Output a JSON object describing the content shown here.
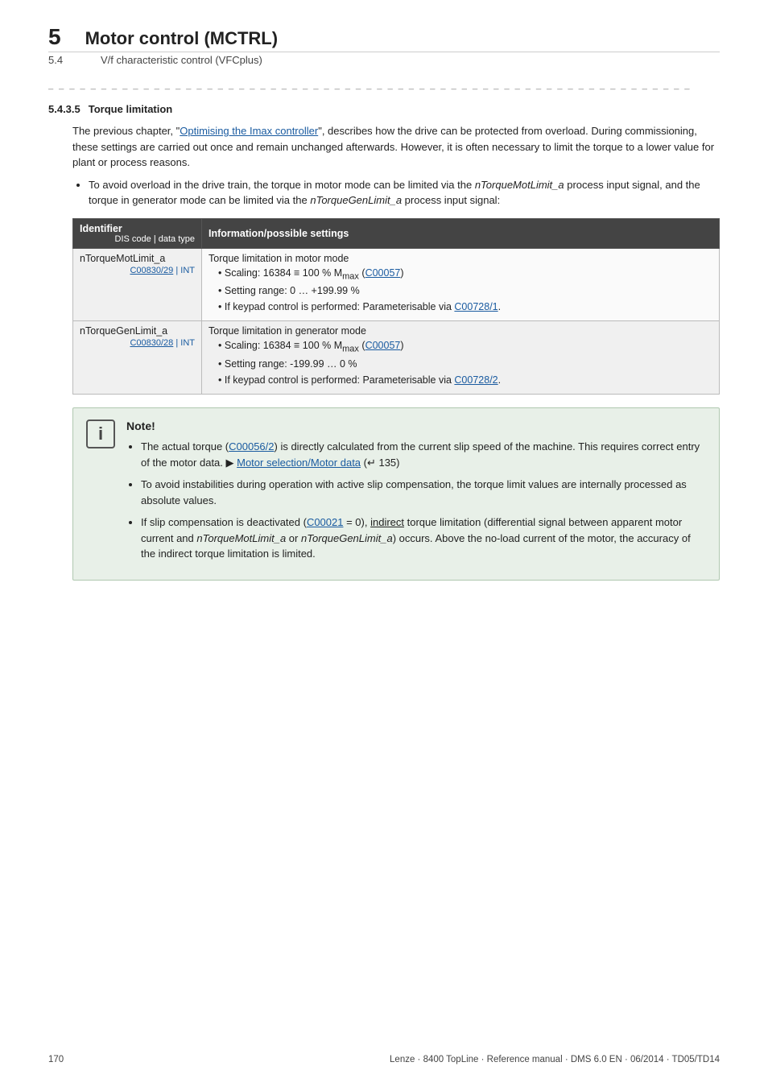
{
  "header": {
    "chapter_number": "5",
    "chapter_title": "Motor control (MCTRL)",
    "sub_number": "5.4",
    "sub_title": "V/f characteristic control (VFCplus)"
  },
  "section": {
    "number": "5.4.3.5",
    "title": "Torque limitation",
    "intro_text": "The previous chapter, \"Optimising the Imax controller\", describes how the drive can be protected from overload. During commissioning, these settings are carried out once and remain unchanged afterwards. However, it is often necessary to limit the torque to a lower value for plant or process reasons.",
    "intro_link_text": "Optimising the Imax controller",
    "bullet_intro": "To avoid overload in the drive train, the torque in motor mode can be limited via the nTorqueMotLimit_a process input signal, and the torque in generator mode can be limited via the nTorqueGenLimit_a process input signal:",
    "table": {
      "col1_header": "Identifier",
      "col1_sub": "DIS code | data type",
      "col2_header": "Information/possible settings",
      "rows": [
        {
          "id_name": "nTorqueMotLimit_a",
          "id_code": "C00830/29 | INT",
          "info_title": "Torque limitation in motor mode",
          "bullets": [
            "Scaling: 16384 ≡ 100 % M<sub>max</sub> (C00057)",
            "Setting range: 0 … +199.99 %",
            "If keypad control is performed: Parameterisable via C00728/1."
          ],
          "links": [
            "C00057",
            "C00728/1"
          ]
        },
        {
          "id_name": "nTorqueGenLimit_a",
          "id_code": "C00830/28 | INT",
          "info_title": "Torque limitation in generator mode",
          "bullets": [
            "Scaling: 16384 ≡ 100 % M<sub>max</sub> (C00057)",
            "Setting range: -199.99 … 0 %",
            "If keypad control is performed: Parameterisable via C00728/2."
          ],
          "links": [
            "C00057",
            "C00728/2"
          ]
        }
      ]
    },
    "note": {
      "title": "Note!",
      "bullets": [
        {
          "text_parts": [
            "The actual torque (",
            "C00056/2",
            ") is directly calculated from the current slip speed of the machine. This requires correct entry of the motor data. ▶ ",
            "Motor selection/Motor data",
            " (↵ 135)"
          ],
          "link1": "C00056/2",
          "link2": "Motor selection/Motor data"
        },
        {
          "text": "To avoid instabilities during operation with active slip compensation, the torque limit values are internally processed as absolute values."
        },
        {
          "text_parts": [
            "If slip compensation is deactivated (",
            "C00021",
            " = 0), indirect torque limitation (differential signal between apparent motor current and ",
            "nTorqueMotLimit_a",
            " or ",
            "nTorqueGenLimit_a",
            ") occurs. Above the no-load current of the motor, the accuracy of the indirect torque limitation is limited."
          ],
          "link1": "C00021"
        }
      ]
    }
  },
  "footer": {
    "page_number": "170",
    "doc_info": "Lenze · 8400 TopLine · Reference manual · DMS 6.0 EN · 06/2014 · TD05/TD14"
  },
  "colors": {
    "accent_blue": "#1a5ba0",
    "table_header_bg": "#444444",
    "note_bg": "#e8f0e8"
  }
}
